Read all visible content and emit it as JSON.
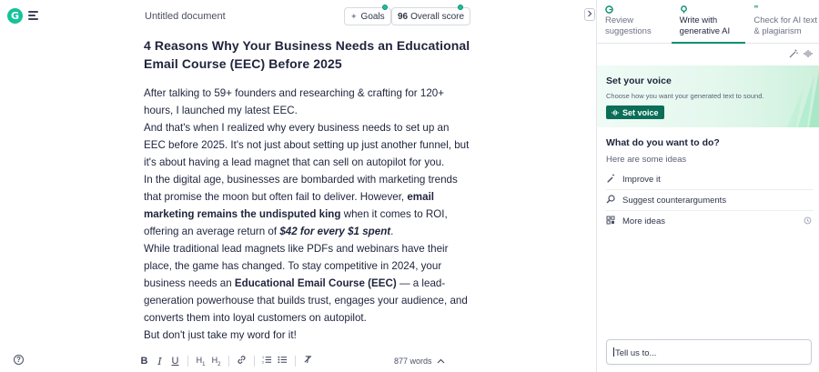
{
  "app": {
    "logo_letter": "G",
    "accent_color": "#15c39a",
    "dark_accent_color": "#0b6e57"
  },
  "header": {
    "doc_title": "Untitled document",
    "goals_label": "Goals",
    "score_value": "96",
    "score_label": "Overall score"
  },
  "document": {
    "heading": "4 Reasons Why Your Business Needs an Educational Email Course (EEC) Before 2025",
    "paragraphs": [
      {
        "runs": [
          {
            "t": "After talking to 59+ founders and researching & crafting for 120+ hours, I launched my latest EEC."
          }
        ]
      },
      {
        "runs": [
          {
            "t": "And that's when I realized why every business needs to set up an EEC before 2025. It's not just about setting up just another funnel, but it's about having a lead magnet that can sell on autopilot for you."
          }
        ]
      },
      {
        "runs": [
          {
            "t": "In the digital age, businesses are bombarded with marketing trends that promise the moon but often fail to deliver. However, "
          },
          {
            "t": "email marketing remains the undisputed king",
            "b": true
          },
          {
            "t": " when it comes to ROI, offering an average return of "
          },
          {
            "t": "$42 for every $1 spent",
            "b": true,
            "i": true
          },
          {
            "t": "."
          }
        ]
      },
      {
        "runs": [
          {
            "t": "While traditional lead magnets like PDFs and webinars have their place, the game has changed. To stay competitive in 2024, your business needs an "
          },
          {
            "t": "Educational Email Course (EEC)",
            "b": true
          },
          {
            "t": " — a lead-generation powerhouse that builds trust, engages your audience, and converts them into loyal customers on autopilot."
          }
        ]
      },
      {
        "runs": [
          {
            "t": "But don't just take my word for it!"
          }
        ]
      }
    ]
  },
  "toolbar": {
    "items": [
      "B",
      "I",
      "U",
      "H1",
      "H2",
      "link",
      "ordered-list",
      "bulleted-list",
      "clear-format"
    ],
    "word_count": "877 words"
  },
  "panel": {
    "tabs": [
      {
        "label": "Review suggestions",
        "active": false
      },
      {
        "label": "Write with generative AI",
        "active": true
      },
      {
        "label": "Check for AI text & plagiarism",
        "active": false
      }
    ],
    "voice": {
      "title": "Set your voice",
      "subtitle": "Choose how you want your generated text to sound.",
      "button": "Set voice"
    },
    "question": "What do you want to do?",
    "ideas_label": "Here are some ideas",
    "options": [
      {
        "label": "Improve it",
        "icon": "pen-sparkle-icon"
      },
      {
        "label": "Suggest counterarguments",
        "icon": "magnifier-icon"
      },
      {
        "label": "More ideas",
        "icon": "grid-icon"
      }
    ],
    "input_placeholder": "Tell us to..."
  }
}
